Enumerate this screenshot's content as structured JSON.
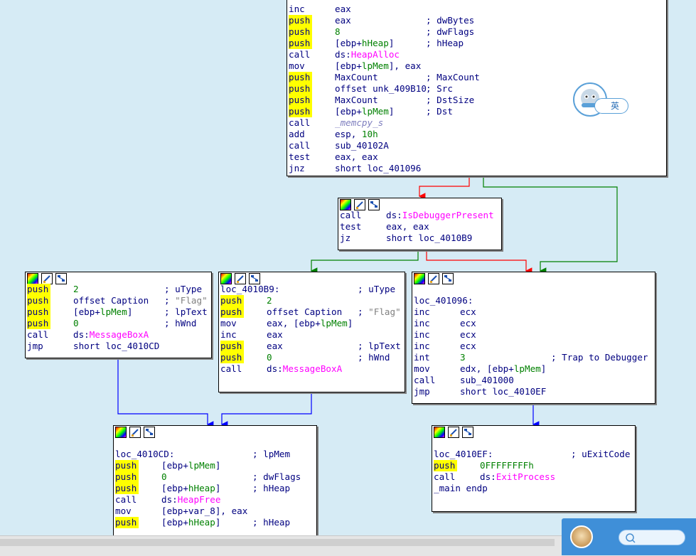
{
  "colors": {
    "background": "#d6ebf5",
    "mnemonic": "#000080",
    "push_highlight": "#ffff00",
    "number": "#008000",
    "import": "#ff00ff",
    "comment": "#000080",
    "string_comment": "#808080",
    "edge_true": "#008000",
    "edge_false": "#ff0000",
    "edge_flow": "#0000ff"
  },
  "ime": {
    "label": "英"
  },
  "nodes": {
    "main_block": {
      "lines": [
        {
          "m": "inc",
          "a": "eax"
        },
        {
          "m": "push",
          "a": "eax",
          "c": "; dwBytes"
        },
        {
          "m": "push",
          "a": "8",
          "c": "; dwFlags"
        },
        {
          "m": "push",
          "a": "[ebp+hHeap]",
          "c": "; hHeap"
        },
        {
          "m": "call",
          "a": "ds:HeapAlloc"
        },
        {
          "m": "mov",
          "a": "[ebp+lpMem], eax"
        },
        {
          "m": "push",
          "a": "MaxCount",
          "c": "; MaxCount"
        },
        {
          "m": "push",
          "a": "offset unk_409B10",
          "c": "; Src"
        },
        {
          "m": "push",
          "a": "MaxCount",
          "c": "; DstSize"
        },
        {
          "m": "push",
          "a": "[ebp+lpMem]",
          "c": "; Dst"
        },
        {
          "m": "call",
          "a": "_memcpy_s"
        },
        {
          "m": "add",
          "a": "esp, 10h"
        },
        {
          "m": "call",
          "a": "sub_40102A"
        },
        {
          "m": "test",
          "a": "eax, eax"
        },
        {
          "m": "jnz",
          "a": "short loc_401096"
        }
      ]
    },
    "debugger_check": {
      "lines": [
        {
          "m": "call",
          "a": "ds:IsDebuggerPresent"
        },
        {
          "m": "test",
          "a": "eax, eax"
        },
        {
          "m": "jz",
          "a": "short loc_4010B9"
        }
      ]
    },
    "msgbox_left": {
      "lines": [
        {
          "m": "push",
          "a": "2",
          "c": "; uType"
        },
        {
          "m": "push",
          "a": "offset Caption",
          "c": "; \"Flag\""
        },
        {
          "m": "push",
          "a": "[ebp+lpMem]",
          "c": "; lpText"
        },
        {
          "m": "push",
          "a": "0",
          "c": "; hWnd"
        },
        {
          "m": "call",
          "a": "ds:MessageBoxA"
        },
        {
          "m": "jmp",
          "a": "short loc_4010CD"
        }
      ]
    },
    "loc_4010B9": {
      "lines": [
        {
          "m": "loc_4010B9:",
          "a": "",
          "c": "; uType"
        },
        {
          "m": "push",
          "a": "2"
        },
        {
          "m": "push",
          "a": "offset Caption",
          "c": "; \"Flag\""
        },
        {
          "m": "mov",
          "a": "eax, [ebp+lpMem]"
        },
        {
          "m": "inc",
          "a": "eax"
        },
        {
          "m": "push",
          "a": "eax",
          "c": "; lpText"
        },
        {
          "m": "push",
          "a": "0",
          "c": "; hWnd"
        },
        {
          "m": "call",
          "a": "ds:MessageBoxA"
        }
      ]
    },
    "loc_401096": {
      "lines": [
        {
          "m": "",
          "a": ""
        },
        {
          "m": "loc_401096:",
          "a": ""
        },
        {
          "m": "inc",
          "a": "ecx"
        },
        {
          "m": "inc",
          "a": "ecx"
        },
        {
          "m": "inc",
          "a": "ecx"
        },
        {
          "m": "inc",
          "a": "ecx"
        },
        {
          "m": "int",
          "a": "3",
          "c": "; Trap to Debugger"
        },
        {
          "m": "mov",
          "a": "edx, [ebp+lpMem]"
        },
        {
          "m": "call",
          "a": "sub_401000"
        },
        {
          "m": "jmp",
          "a": "short loc_4010EF"
        }
      ]
    },
    "loc_4010CD": {
      "lines": [
        {
          "m": "",
          "a": ""
        },
        {
          "m": "loc_4010CD:",
          "a": "",
          "c": "; lpMem"
        },
        {
          "m": "push",
          "a": "[ebp+lpMem]"
        },
        {
          "m": "push",
          "a": "0",
          "c": "; dwFlags"
        },
        {
          "m": "push",
          "a": "[ebp+hHeap]",
          "c": "; hHeap"
        },
        {
          "m": "call",
          "a": "ds:HeapFree"
        },
        {
          "m": "mov",
          "a": "[ebp+var_8], eax"
        },
        {
          "m": "push",
          "a": "[ebp+hHeap]",
          "c": "; hHeap"
        }
      ]
    },
    "loc_4010EF": {
      "lines": [
        {
          "m": "",
          "a": ""
        },
        {
          "m": "loc_4010EF:",
          "a": "",
          "c": "; uExitCode"
        },
        {
          "m": "push",
          "a": "0FFFFFFFFh"
        },
        {
          "m": "call",
          "a": "ds:ExitProcess"
        },
        {
          "m": "_main endp",
          "a": ""
        }
      ]
    }
  }
}
